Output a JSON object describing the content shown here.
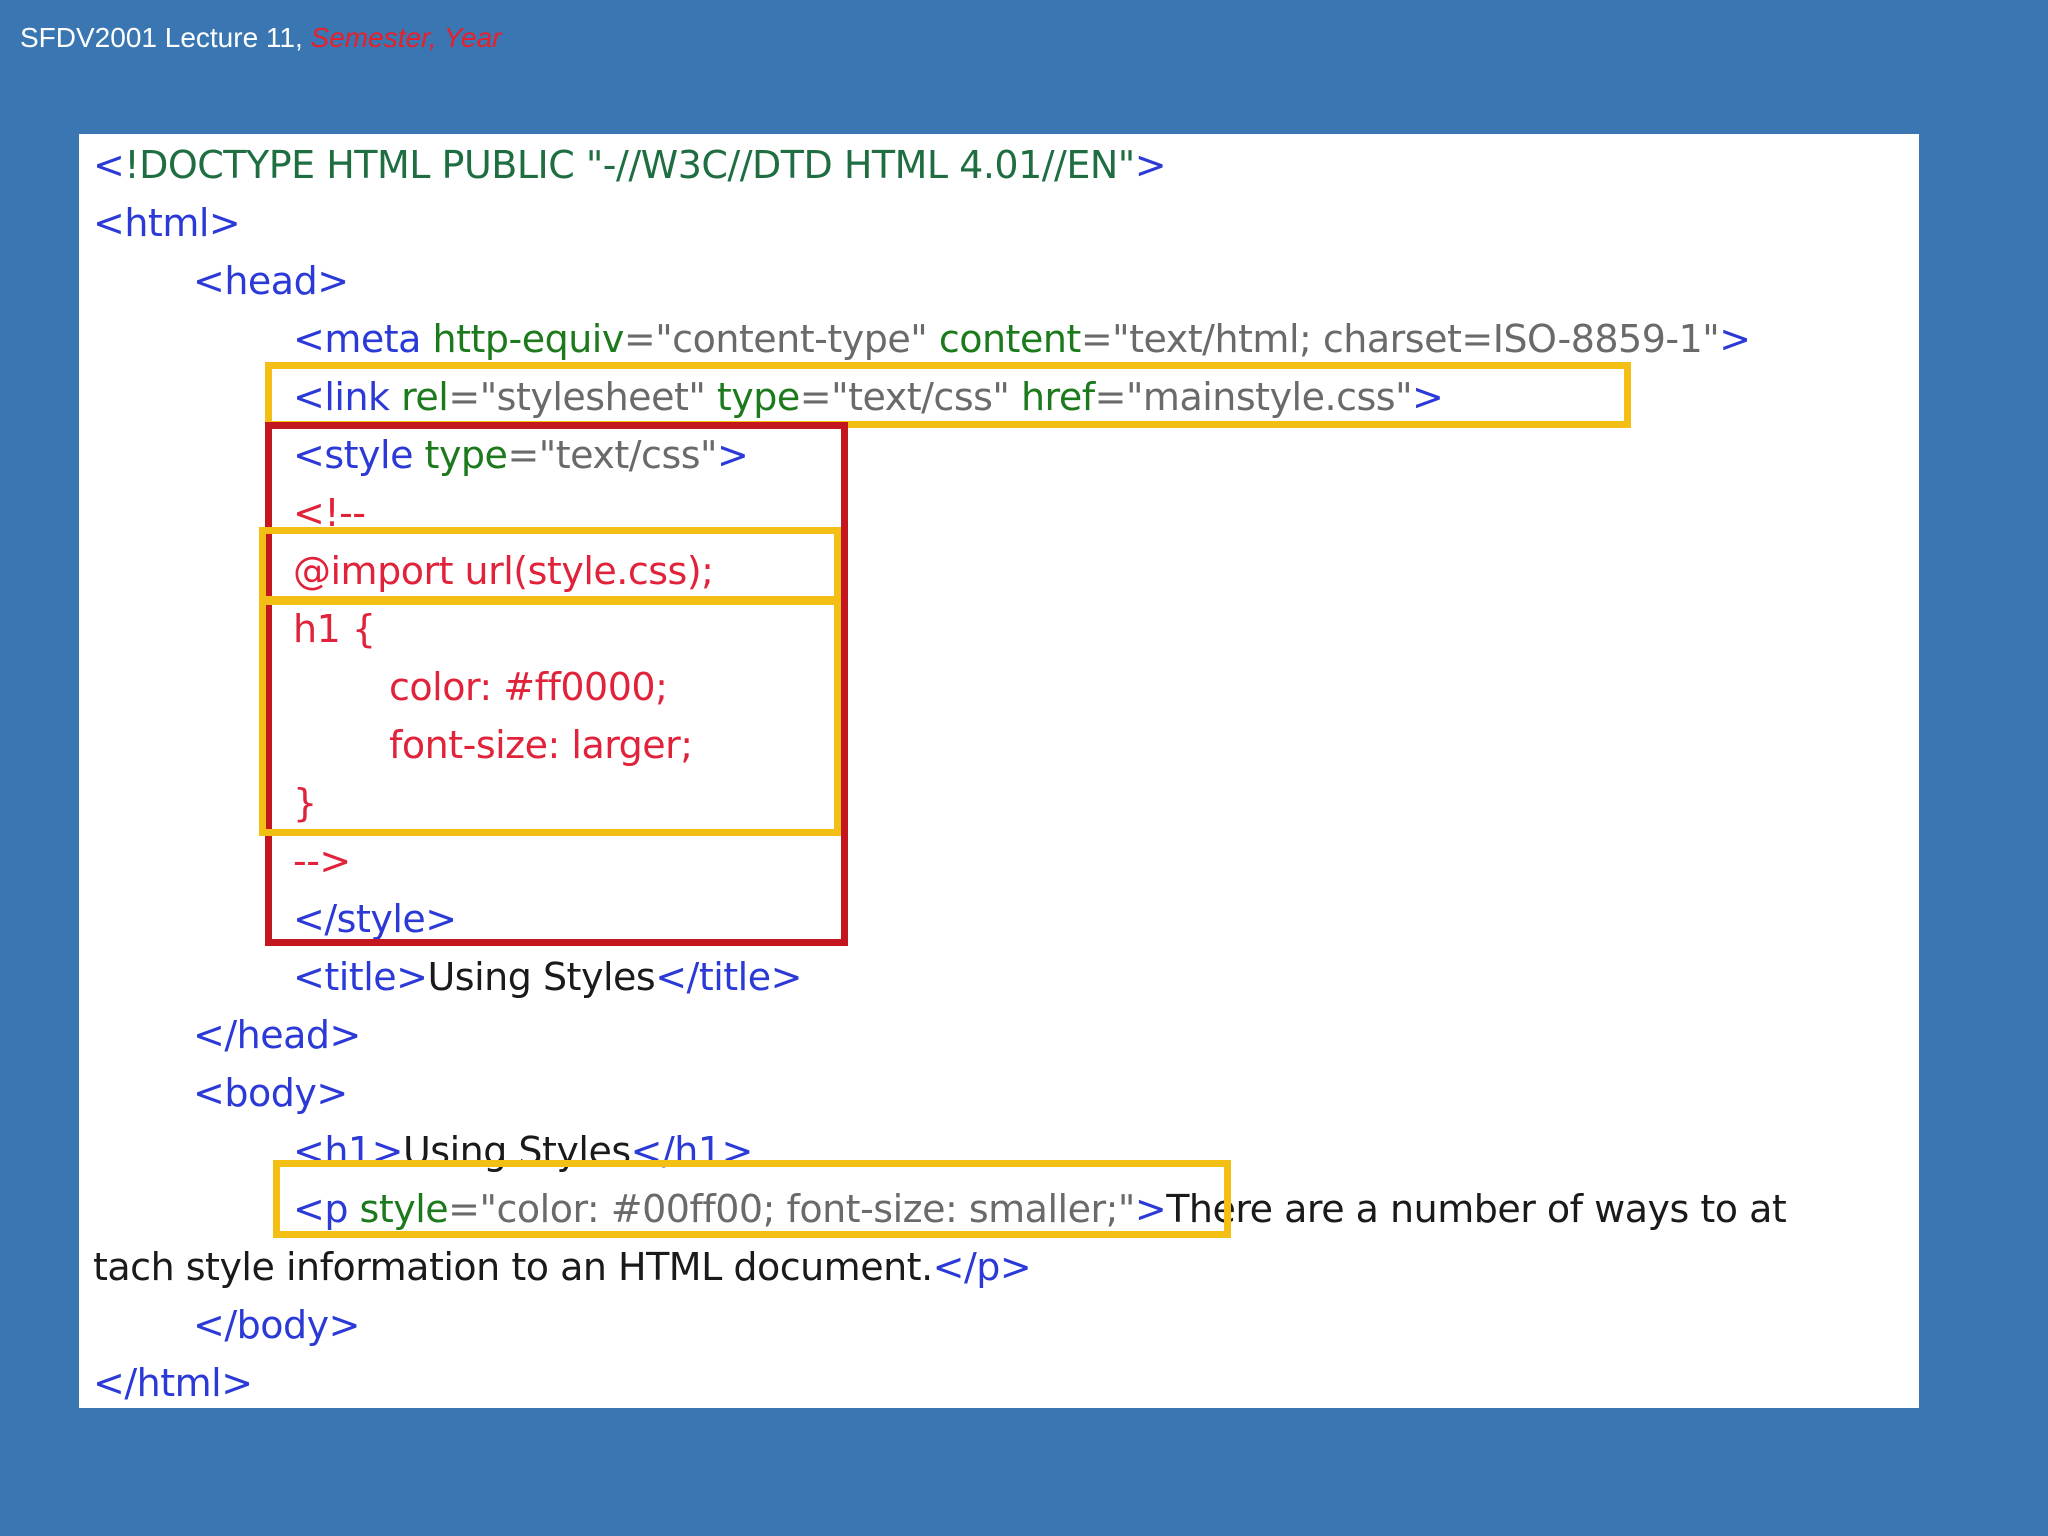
{
  "header": {
    "course": "SFDV2001 Lecture 11, ",
    "term": "Semester, Year"
  },
  "code": {
    "l1_open": "<",
    "l1_doctype": "!DOCTYPE HTML PUBLIC ",
    "l1_str": "\"-//W3C//DTD HTML 4.01//EN\"",
    "l1_close": ">",
    "l2": "<html>",
    "l3": "<head>",
    "l4_tag": "<meta ",
    "l4_attr1": "http-equiv",
    "l4_eq1": "=",
    "l4_val1": "\"content-type\" ",
    "l4_attr2": "content",
    "l4_eq2": "=",
    "l4_val2": "\"text/html; charset=ISO-8859-1\"",
    "l4_close": ">",
    "l5_tag": "<link ",
    "l5_attr1": "rel",
    "l5_eq1": "=",
    "l5_val1": "\"stylesheet\" ",
    "l5_attr2": "type",
    "l5_eq2": "=",
    "l5_val2": "\"text/css\" ",
    "l5_attr3": "href",
    "l5_eq3": "=",
    "l5_val3": "\"mainstyle.css\"",
    "l5_close": ">",
    "l6_tag": "<style ",
    "l6_attr": "type",
    "l6_eq": "=",
    "l6_val": "\"text/css\"",
    "l6_close": ">",
    "l7": "<!--",
    "l8": "@import url(style.css);",
    "l9": "h1 {",
    "l10": "color: #ff0000;",
    "l11": "font-size: larger;",
    "l12": "}",
    "l13": "-->",
    "l14": "</style>",
    "l15_open": "<title>",
    "l15_text": "Using Styles",
    "l15_close": "</title>",
    "l16": "</head>",
    "l17": "<body>",
    "l18_open": "<h1>",
    "l18_text": "Using Styles",
    "l18_close": "</h1>",
    "l19_tag": "<p ",
    "l19_attr": "style",
    "l19_eq": "=",
    "l19_val": "\"color: #00ff00; font-size: smaller;\"",
    "l19_close": ">",
    "l19_text": "There are a number of ways to at",
    "l20_text": "tach style information to an HTML document.",
    "l20_close": "</p>",
    "l21": "</body>",
    "l22": "</html>"
  },
  "colors": {
    "background": "#3a76b2",
    "panel": "#ffffff",
    "highlight_yellow": "#f4bf15",
    "highlight_red": "#c4161f",
    "tag": "#2b3ad6",
    "attribute": "#1c7a1c",
    "string": "#6a6a6a",
    "comment_css": "#e0233a"
  }
}
